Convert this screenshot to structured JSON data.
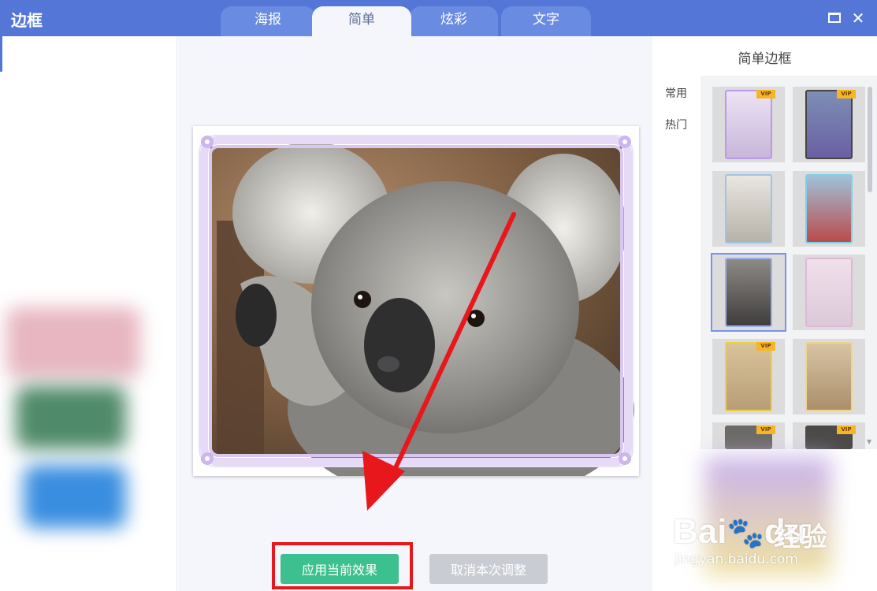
{
  "window": {
    "title": "边框",
    "controls": {
      "maximize": "maximize",
      "close": "✕"
    }
  },
  "tabs": [
    {
      "label": "海报",
      "active": false
    },
    {
      "label": "简单",
      "active": true
    },
    {
      "label": "炫彩",
      "active": false
    },
    {
      "label": "文字",
      "active": false
    }
  ],
  "preview": {
    "frame_color": "#d8c7f2",
    "flower_color": "#cbb6ee"
  },
  "actions": {
    "apply_label": "应用当前效果",
    "cancel_label": "取消本次调整"
  },
  "right_panel": {
    "title": "简单边框",
    "categories": [
      "常用",
      "热门"
    ],
    "vip_badge": "VIP"
  },
  "watermark": {
    "brand": "Bai",
    "brand2": "du",
    "cn": "经验",
    "url": "jingyan.baidu.com"
  },
  "colors": {
    "accent": "#5476d6",
    "apply": "#3dc08f",
    "cancel": "#c9ccd2",
    "highlight": "#e8171b",
    "arrow": "#e8171b"
  }
}
